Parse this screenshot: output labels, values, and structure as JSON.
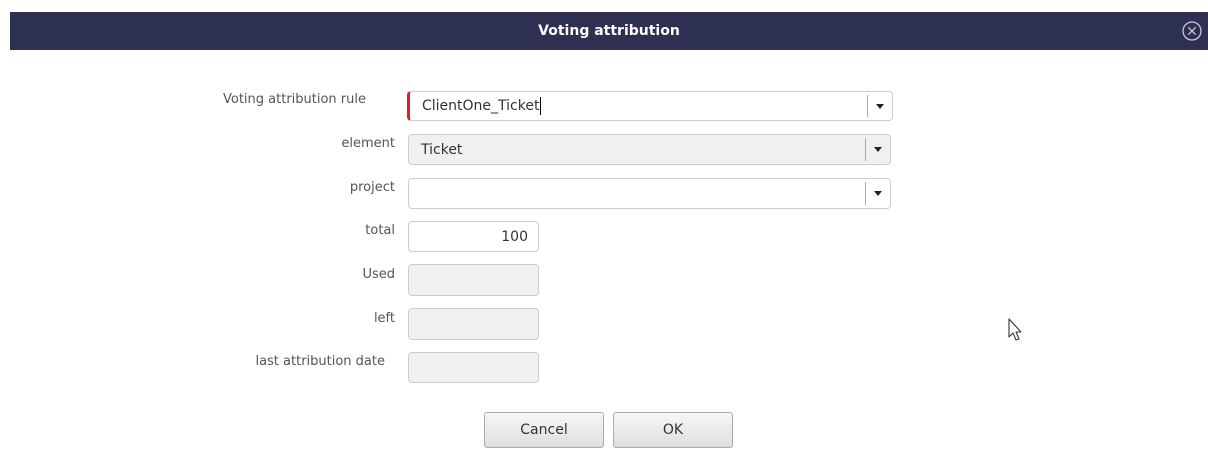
{
  "dialog": {
    "title": "Voting attribution"
  },
  "form": {
    "rule": {
      "label": "Voting attribution rule",
      "value": "ClientOne_Ticket"
    },
    "element": {
      "label": "element",
      "value": "Ticket"
    },
    "project": {
      "label": "project",
      "value": ""
    },
    "total": {
      "label": "total",
      "value": "100"
    },
    "used": {
      "label": "Used",
      "value": ""
    },
    "left": {
      "label": "left",
      "value": ""
    },
    "last_date": {
      "label": "last attribution date",
      "value": ""
    }
  },
  "buttons": {
    "cancel": "Cancel",
    "ok": "OK"
  },
  "icons": {
    "close": "close-circle-icon",
    "dropdown": "caret-down-icon",
    "cursor": "mouse-pointer-icon"
  },
  "colors": {
    "title_bar": "#2e3052",
    "required_marker": "#e02020"
  }
}
